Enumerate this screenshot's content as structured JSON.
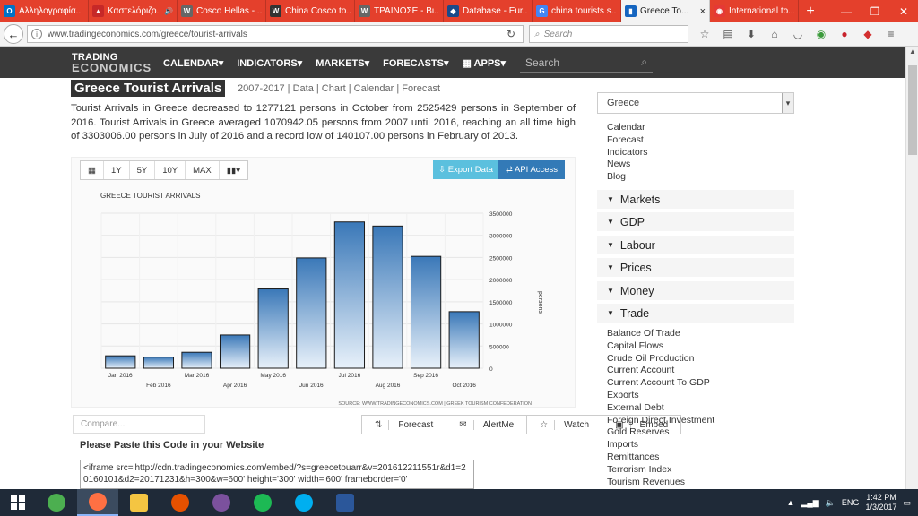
{
  "browser": {
    "tabs": [
      {
        "label": "Αλληλογραφία...",
        "icon": "outlook-icon",
        "color": "#0072c6",
        "glyph": "O"
      },
      {
        "label": "Καστελόριζο...",
        "icon": "news-icon",
        "color": "#c62828",
        "glyph": "▲"
      },
      {
        "label": "Cosco Hellas - ...",
        "icon": "wikipedia-icon",
        "color": "#666",
        "glyph": "W"
      },
      {
        "label": "China Cosco to...",
        "icon": "wsj-icon",
        "color": "#333",
        "glyph": "W"
      },
      {
        "label": "ΤΡΑΙΝΟΣΕ - Βι...",
        "icon": "wikipedia-icon",
        "color": "#666",
        "glyph": "W"
      },
      {
        "label": "Database - Eur...",
        "icon": "eurostat-icon",
        "color": "#1a4a8a",
        "glyph": "◆"
      },
      {
        "label": "china tourists s...",
        "icon": "google-icon",
        "color": "#4285f4",
        "glyph": "G"
      },
      {
        "label": "Greece To...",
        "icon": "tradingeconomics-icon",
        "color": "#1565c0",
        "glyph": "▮"
      },
      {
        "label": "International to...",
        "icon": "web-icon",
        "color": "#e53935",
        "glyph": "◉"
      }
    ],
    "active_tab": 7,
    "url": "www.tradingeconomics.com/greece/tourist-arrivals",
    "search_placeholder": "Search"
  },
  "site": {
    "logo_line1": "TRADING",
    "logo_line2": "ECONOMICS",
    "nav": [
      "CALENDAR▾",
      "INDICATORS▾",
      "MARKETS▾",
      "FORECASTS▾"
    ],
    "apps": "APPS▾",
    "search_placeholder": "Search"
  },
  "page": {
    "title": "Greece Tourist Arrivals",
    "subnav": "2007-2017 | Data | Chart | Calendar | Forecast",
    "description": "Tourist Arrivals in Greece decreased to 1277121 persons in October from 2525429 persons in September of 2016. Tourist Arrivals in Greece averaged 1070942.05 persons from 2007 until 2016, reaching an all time high of 3303006.00 persons in July of 2016 and a record low of 140107.00 persons in February of 2013.",
    "chart_toolbar": [
      "▦",
      "1Y",
      "5Y",
      "10Y",
      "MAX",
      "▮▮▾"
    ],
    "export_label": "⇩ Export Data",
    "api_label": "⇄ API Access",
    "compare_placeholder": "Compare...",
    "actions": [
      {
        "label": "Forecast",
        "glyph": "⇅",
        "icon": "forecast-icon"
      },
      {
        "label": "AlertMe",
        "glyph": "✉",
        "icon": "mail-icon"
      },
      {
        "label": "Watch",
        "glyph": "☆",
        "icon": "star-icon"
      },
      {
        "label": "Embed",
        "glyph": "▣",
        "icon": "image-icon"
      }
    ],
    "paste_title": "Please Paste this Code in your Website",
    "embed_code": "<iframe src='http://cdn.tradingeconomics.com/embed/?s=greecetouarr&v=201612211551r&d1=20160101&d2=20171231&h=300&w=600' height='300' width='600'  frameborder='0'"
  },
  "chart_data": {
    "type": "bar",
    "title": "GREECE TOURIST ARRIVALS",
    "ylabel": "persons",
    "source": "SOURCE: WWW.TRADINGECONOMICS.COM | GREEK TOURISM CONFEDERATION",
    "categories": [
      "Jan 2016",
      "Feb 2016",
      "Mar 2016",
      "Apr 2016",
      "May 2016",
      "Jun 2016",
      "Jul 2016",
      "Aug 2016",
      "Sep 2016",
      "Oct 2016"
    ],
    "values": [
      280000,
      250000,
      360000,
      750000,
      1790000,
      2490000,
      3303006,
      3210000,
      2525429,
      1277121
    ],
    "ylim": [
      0,
      3500000
    ],
    "yticks": [
      0,
      500000,
      1000000,
      1500000,
      2000000,
      2500000,
      3000000,
      3500000
    ],
    "ytick_labels": [
      "0",
      "500000",
      "1000000",
      "1500000",
      "2000000",
      "2500000",
      "3000000",
      "3500000"
    ],
    "grid": true,
    "bar_color_top": "#3a78b8",
    "bar_color_bottom": "#e8f1fa"
  },
  "sidebar": {
    "country": "Greece",
    "links": [
      "Calendar",
      "Forecast",
      "Indicators",
      "News",
      "Blog"
    ],
    "sections": [
      "Markets",
      "GDP",
      "Labour",
      "Prices",
      "Money",
      "Trade"
    ],
    "trade_links": [
      "Balance Of Trade",
      "Capital Flows",
      "Crude Oil Production",
      "Current Account",
      "Current Account To GDP",
      "Exports",
      "External Debt",
      "Foreign Direct Investment",
      "Gold Reserves",
      "Imports",
      "Remittances",
      "Terrorism Index",
      "Tourism Revenues"
    ]
  },
  "taskbar": {
    "apps": [
      {
        "name": "chrome-icon",
        "color": "#4caf50"
      },
      {
        "name": "firefox-icon",
        "color": "#ff7043"
      },
      {
        "name": "file-explorer-icon",
        "color": "#f4c542"
      },
      {
        "name": "media-player-icon",
        "color": "#e65100"
      },
      {
        "name": "viber-icon",
        "color": "#7b519d"
      },
      {
        "name": "spotify-icon",
        "color": "#1db954"
      },
      {
        "name": "skype-icon",
        "color": "#00aff0"
      },
      {
        "name": "word-icon",
        "color": "#2b579a"
      }
    ],
    "active_app": 1,
    "language": "ENG",
    "time": "1:42 PM",
    "date": "1/3/2017"
  }
}
